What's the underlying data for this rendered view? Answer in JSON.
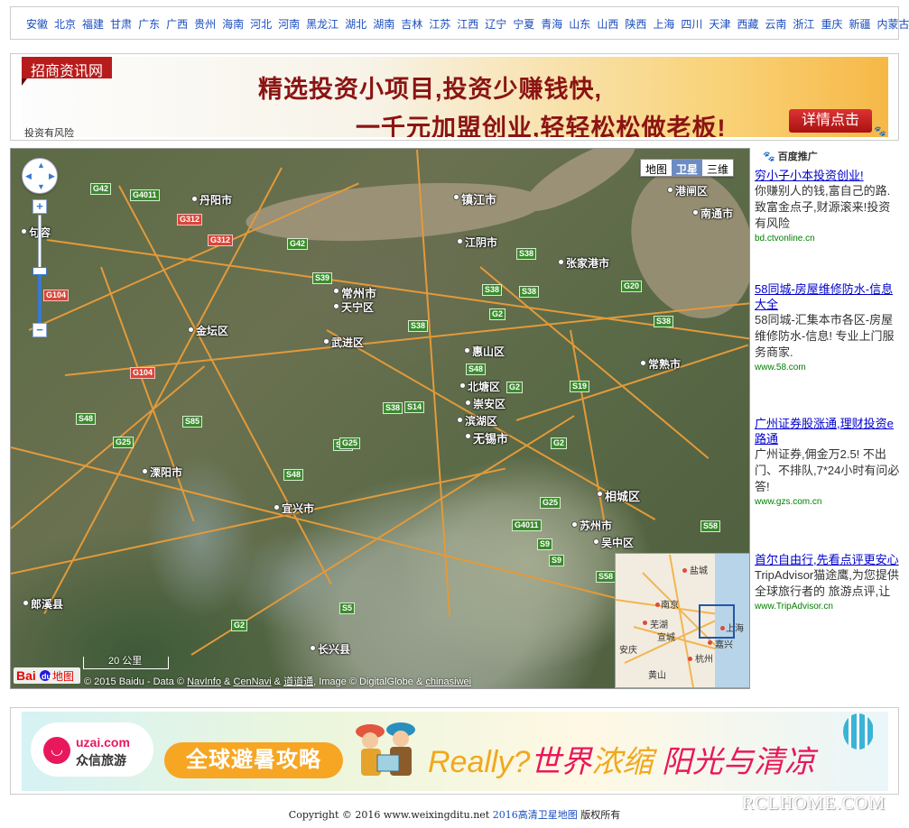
{
  "nav": {
    "provinces": [
      "安徽",
      "北京",
      "福建",
      "甘肃",
      "广东",
      "广西",
      "贵州",
      "海南",
      "河北",
      "河南",
      "黑龙江",
      "湖北",
      "湖南",
      "吉林",
      "江苏",
      "江西",
      "辽宁",
      "宁夏",
      "青海",
      "山东",
      "山西",
      "陕西",
      "上海",
      "四川",
      "天津",
      "西藏",
      "云南",
      "浙江",
      "重庆",
      "新疆",
      "内蒙古"
    ]
  },
  "ad_top": {
    "brand": "招商资讯网",
    "line1": "精选投资小项目,投资少赚钱快,",
    "line2": "一千元加盟创业,轻轻松松做老板!",
    "button": "详情点击",
    "risk": "投资有风险",
    "colors": {
      "brand_bg": "#b71c1c",
      "text": "#8b1413",
      "button": "#c62828"
    }
  },
  "map": {
    "types": {
      "map": "地图",
      "satellite": "卫星",
      "three_d": "三维",
      "active": "satellite"
    },
    "zoom_level_fraction": 0.48,
    "scale_label": "20 公里",
    "logo": "Bai地图",
    "copyright": {
      "prefix": "© 2015 Baidu - Data © ",
      "navinfo": "NavInfo",
      "amp": " & ",
      "cennavi": "CenNavi",
      "daodao": "道道通",
      "image": ", Image © DigitalGlobe & ",
      "chinasiwei": "chinasiwei"
    },
    "cities": [
      "镇江市",
      "丹阳市",
      "句容",
      "江阴市",
      "张家港市",
      "港闸区",
      "南通市",
      "常州市",
      "天宁区",
      "金坛区",
      "武进区",
      "惠山区",
      "北塘区",
      "崇安区",
      "滨湖区",
      "无锡市",
      "常熟市",
      "溧阳市",
      "宜兴市",
      "相城区",
      "苏州市",
      "吴中区",
      "郎溪县",
      "长兴县"
    ],
    "road_signs": [
      "G42",
      "G4011",
      "G312",
      "G312",
      "G42",
      "G104",
      "S39",
      "S38",
      "S38",
      "S38",
      "S38",
      "G2",
      "S38",
      "S48",
      "G2",
      "S19",
      "G20",
      "S38",
      "G2",
      "S48",
      "S85",
      "G25",
      "S48",
      "S48",
      "G104",
      "G4011",
      "G25",
      "S9",
      "S9",
      "S58",
      "S58",
      "G2",
      "S5",
      "S14",
      "G25",
      "S6"
    ],
    "minimap": {
      "labels": [
        "盐城",
        "南京",
        "芜湖",
        "宣城",
        "上海",
        "嘉兴",
        "安庆",
        "杭州",
        "黄山"
      ]
    }
  },
  "sidebar": {
    "header": "百度推广",
    "ads": [
      {
        "title": "穷小子小本投资创业!",
        "desc": "你赚别人的钱,富自己的路. 致富金点子,财源滚来!投资有风险",
        "url": "bd.ctvonline.cn"
      },
      {
        "title": "58同城-房屋维修防水-信息大全",
        "desc": "58同城-汇集本市各区-房屋维修防水-信息! 专业上门服务商家.",
        "url": "www.58.com"
      },
      {
        "title": "广州证券股涨通,理财投资e路通",
        "desc": "广州证券,佣金万2.5! 不出门、不排队,7*24小时有问必答!",
        "url": "www.gzs.com.cn"
      },
      {
        "title": "首尔自由行,先看点评更安心",
        "desc": "TripAdvisor猫途鹰,为您提供全球旅行者的 旅游点评,让",
        "url": "www.TripAdvisor.cn"
      }
    ]
  },
  "ad_bottom": {
    "logo_domain": "uzai.com",
    "logo_name": "众信旅游",
    "pill": "全球避暑攻略",
    "slogan_a": "Really?",
    "slogan_b": "世界",
    "slogan_c": "浓缩",
    "slogan_d": "阳光与清凉",
    "colors": {
      "brand": "#e8185c",
      "accent": "#f6a623"
    }
  },
  "footer": {
    "prefix": "Copyright © 2016 www.weixingditu.net ",
    "site": "2016高清卫星地图",
    "suffix": " 版权所有"
  },
  "watermark": "RCLHOME.COM"
}
